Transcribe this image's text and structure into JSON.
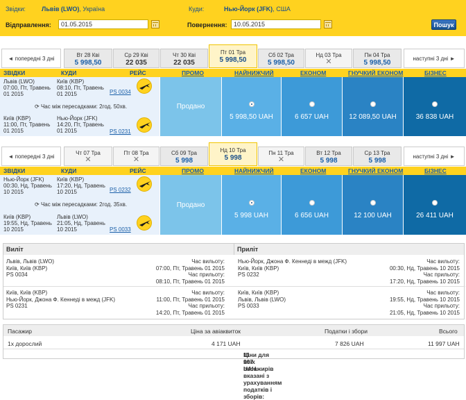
{
  "search": {
    "from_label": "Звідки:",
    "from_city": "Львів (LWO)",
    "from_country": ", Україна",
    "to_label": "Куди:",
    "to_city": "Нью-Йорк (JFK)",
    "to_country": ", США",
    "depart_label": "Відправлення:",
    "depart_value": "01.05.2015",
    "return_label": "Повернення:",
    "return_value": "10.05.2015",
    "search_button": "Пошук"
  },
  "outbound": {
    "prev_label": "попередні 3 дні",
    "next_label": "наступні 3 дні",
    "tabs": [
      {
        "day": "Вт 28 Кві",
        "price": "5 998,50"
      },
      {
        "day": "Ср 29 Кві",
        "price": "22 035"
      },
      {
        "day": "Чт 30 Кві",
        "price": "22 035"
      },
      {
        "day": "Пт 01 Тра",
        "price": "5 998,50"
      },
      {
        "day": "Сб 02 Тра",
        "price": "5 998,50"
      },
      {
        "day": "Нд 03 Тра",
        "price": "✕"
      },
      {
        "day": "Пн 04 Тра",
        "price": "5 998,50"
      }
    ],
    "legs": [
      {
        "from": "Львів (LWO)",
        "from_time": "07:00, Пт, Травень",
        "from_year": "01 2015",
        "to": "Київ (KBP)",
        "to_time": "08:10, Пт, Травень",
        "to_year": "01 2015",
        "code": "PS 0034"
      },
      {
        "from": "Київ (KBP)",
        "from_time": "11:00, Пт, Травень",
        "from_year": "01 2015",
        "to": "Нью-Йорк (JFK)",
        "to_time": "14:20, Пт, Травень",
        "to_year": "01 2015",
        "code": "PS 0231"
      }
    ],
    "transfer": "Час між пересадками: 2год. 50хв.",
    "sold": "Продано",
    "prices": [
      "5 998,50 UAH",
      "6 657 UAH",
      "12 089,50 UAH",
      "36 838 UAH"
    ]
  },
  "inbound": {
    "prev_label": "попередні 3 дні",
    "next_label": "наступні 3 дні",
    "tabs": [
      {
        "day": "Чт 07 Тра",
        "price": "✕"
      },
      {
        "day": "Пт 08 Тра",
        "price": "✕"
      },
      {
        "day": "Сб 09 Тра",
        "price": "5 998"
      },
      {
        "day": "Нд 10 Тра",
        "price": "5 998"
      },
      {
        "day": "Пн 11 Тра",
        "price": "✕"
      },
      {
        "day": "Вт 12 Тра",
        "price": "5 998"
      },
      {
        "day": "Ср 13 Тра",
        "price": "5 998"
      }
    ],
    "legs": [
      {
        "from": "Нью-Йорк (JFK)",
        "from_time": "00:30, Нд, Травень",
        "from_year": "10 2015",
        "to": "Київ (KBP)",
        "to_time": "17:20, Нд, Травень",
        "to_year": "10 2015",
        "code": "PS 0232"
      },
      {
        "from": "Київ (KBP)",
        "from_time": "19:55, Нд, Травень",
        "from_year": "10 2015",
        "to": "Львів (LWO)",
        "to_time": "21:05, Нд, Травень",
        "to_year": "10 2015",
        "code": "PS 0033"
      }
    ],
    "transfer": "Час між пересадками: 2год. 35хв.",
    "sold": "Продано",
    "prices": [
      "5 998 UAH",
      "6 656 UAH",
      "12 100 UAH",
      "26 411 UAH"
    ]
  },
  "columns": {
    "from": "ЗВІДКИ",
    "to": "КУДИ",
    "flight": "РЕЙС",
    "promo": "ПРОМО",
    "lowest": "НАЙНИЖЧИЙ",
    "economy": "ЕКОНОМ",
    "flex_economy": "ГНУЧКИЙ ЕКОНОМ",
    "business": "БІЗНЕС"
  },
  "summary": {
    "depart_title": "Виліт",
    "return_title": "Приліт",
    "dep_label": "Час вильоту:",
    "arr_label": "Час прильоту:",
    "out_rows": [
      {
        "line1": "Львів, Львів (LWO)",
        "line2": "Київ, Київ (KBP)",
        "line3": "PS 0034",
        "dep": "07:00, Пт, Травень 01 2015",
        "arr": "08:10, Пт, Травень 01 2015"
      },
      {
        "line1": "Київ, Київ (KBP)",
        "line2": "Нью-Йорк, Джона Ф. Кеннеді в межд (JFK)",
        "line3": "PS 0231",
        "dep": "11:00, Пт, Травень 01 2015",
        "arr": "14:20, Пт, Травень 01 2015"
      }
    ],
    "ret_rows": [
      {
        "line1": "Нью-Йорк, Джона Ф. Кеннеді в межд (JFK)",
        "line2": "Київ, Київ (KBP)",
        "line3": "PS 0232",
        "dep": "00:30, Нд, Травень 10 2015",
        "arr": "17:20, Нд, Травень 10 2015"
      },
      {
        "line1": "Київ, Київ (KBP)",
        "line2": "Львів, Львів (LWO)",
        "line3": "PS 0033",
        "dep": "19:55, Нд, Травень 10 2015",
        "arr": "21:05, Нд, Травень 10 2015"
      }
    ]
  },
  "fare": {
    "passenger_h": "Пасажир",
    "ticket_h": "Ціна за авіаквиток",
    "tax_h": "Податки і збори",
    "total_h": "Всього",
    "passenger": "1х дорослий",
    "ticket": "4 171 UAH",
    "tax": "7 826 UAH",
    "total": "11 997 UAH",
    "note": "Ціни для всіх пасажирів вказані з урахуванням податків і зборів:",
    "note_total": "11 997 UAH"
  },
  "colors": {
    "brand_yellow": "#ffd21f",
    "link_blue": "#1a5fa8",
    "dark_blue": "#0f6aa5"
  }
}
